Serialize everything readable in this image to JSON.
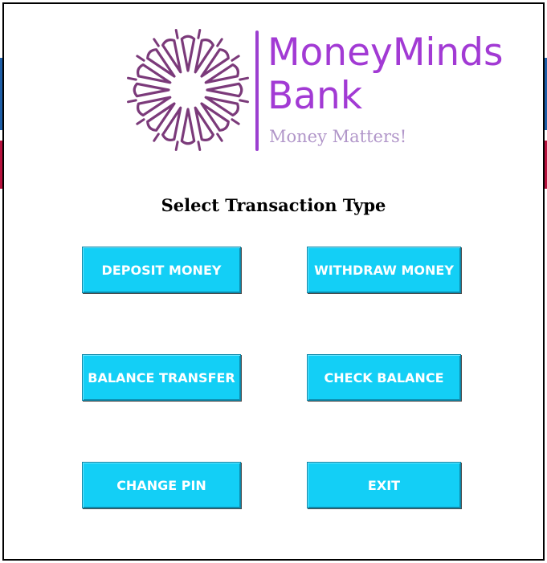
{
  "brand": {
    "name_line1": "MoneyMinds",
    "name_line2": "Bank",
    "tagline": "Money Matters!",
    "logo_icon": "starburst-logo-icon",
    "color_primary": "#a23ad4",
    "color_mark": "#7b3a7a",
    "color_tagline": "#b196c9"
  },
  "heading": "Select Transaction Type",
  "buttons": {
    "deposit": "DEPOSIT MONEY",
    "withdraw": "WITHDRAW MONEY",
    "transfer": "BALANCE TRANSFER",
    "check": "CHECK BALANCE",
    "pin": "CHANGE PIN",
    "exit": "EXIT"
  },
  "colors": {
    "button_bg": "#13cff6",
    "button_text": "#ffffff"
  }
}
